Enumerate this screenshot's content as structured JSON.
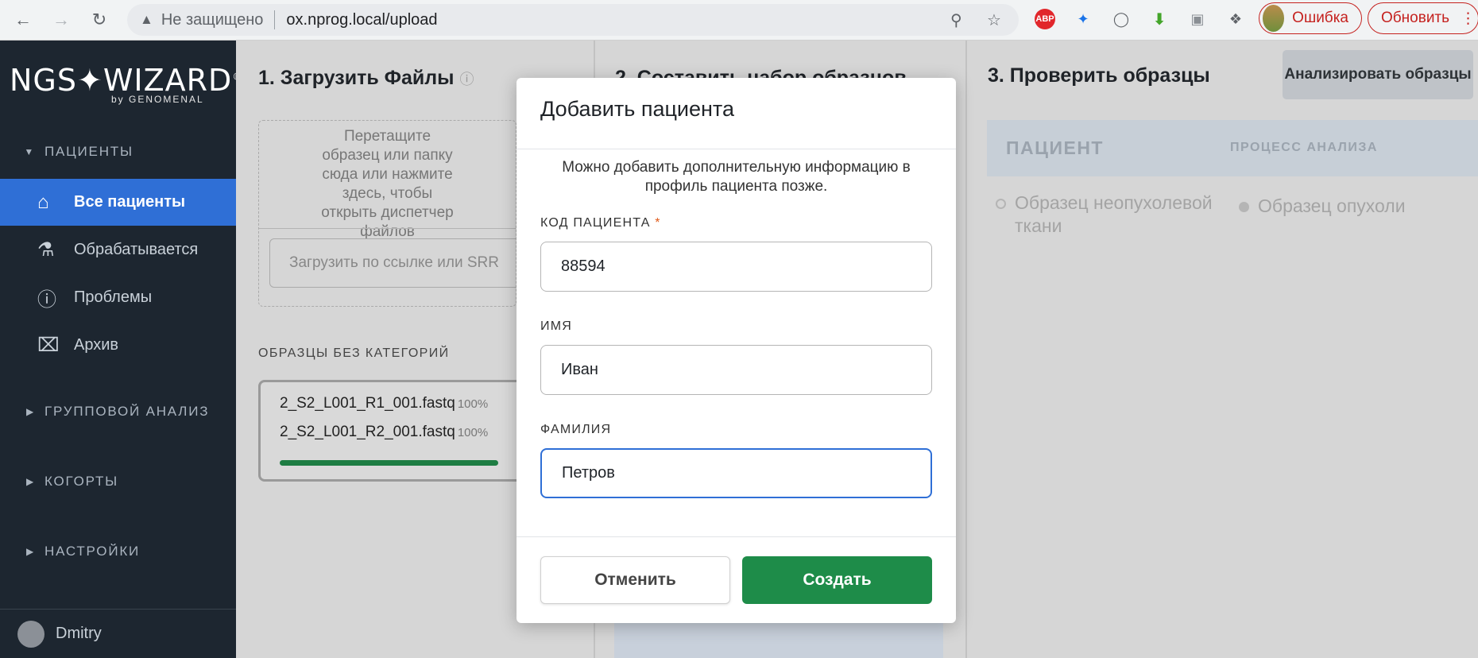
{
  "browser": {
    "insecure_label": "Не защищено",
    "url": "ox.nprog.local/upload",
    "error_label": "Ошибка",
    "update_label": "Обновить",
    "abp_label": "ABP"
  },
  "sidebar": {
    "logo": "NGS✦WIZARD",
    "logo_mark": "®",
    "logo_sub": "by GENOMENAL",
    "patients_section": "ПАЦИЕНТЫ",
    "items": [
      {
        "label": "Все пациенты",
        "icon": "home-icon"
      },
      {
        "label": "Обрабатывается",
        "icon": "flask-icon"
      },
      {
        "label": "Проблемы",
        "icon": "alert-icon"
      },
      {
        "label": "Архив",
        "icon": "archive-icon"
      }
    ],
    "group_section": "ГРУППОВОЙ АНАЛИЗ",
    "cohorts_section": "КОГОРТЫ",
    "settings_section": "НАСТРОЙКИ",
    "user_name": "Dmitry"
  },
  "columns": {
    "upload_title": "1. Загрузить Файлы",
    "compose_title": "2. Составить набор образцов",
    "check_title": "3. Проверить образцы",
    "analyze_button": "Анализировать образцы"
  },
  "upload": {
    "drop_text": "Перетащите образец или папку сюда или нажмите здесь, чтобы открыть диспетчер файлов",
    "url_placeholder": "Загрузить по ссылке или SRR",
    "uncategorized_label": "ОБРАЗЦЫ БЕЗ КАТЕГОРИЙ",
    "files": [
      {
        "name": "2_S2_L001_R1_001.fastq",
        "percent": "100%"
      },
      {
        "name": "2_S2_L001_R2_001.fastq",
        "percent": "100%"
      }
    ],
    "progress": 1.0
  },
  "check": {
    "col_patient": "ПАЦИЕНТ",
    "col_process": "ПРОЦЕСС АНАЛИЗА",
    "normal_sample": "Образец неопухолевой ткани",
    "tumor_sample": "Образец опухоли"
  },
  "modal": {
    "title": "Добавить пациента",
    "description": "Можно добавить дополнительную информацию в профиль пациента позже.",
    "code_label": "КОД ПАЦИЕНТА",
    "required_mark": "*",
    "code_value": "88594",
    "first_name_label": "ИМЯ",
    "first_name_value": "Иван",
    "last_name_label": "ФАМИЛИЯ",
    "last_name_value": "Петров",
    "cancel_label": "Отменить",
    "create_label": "Создать"
  },
  "colors": {
    "sidebar_bg": "#1d2630",
    "active_item": "#2f6fd6",
    "primary_green": "#1e8c49",
    "error_red": "#c5221f"
  }
}
